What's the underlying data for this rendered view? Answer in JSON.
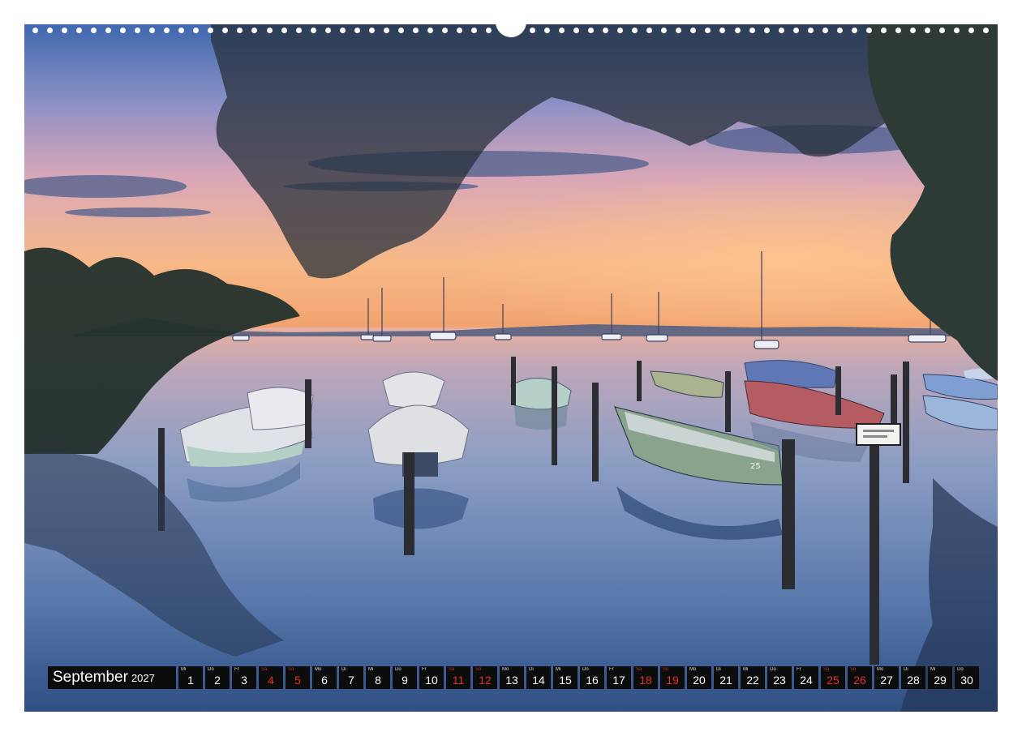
{
  "calendar": {
    "month": "September",
    "year": "2027",
    "days": [
      {
        "wd": "Mi",
        "n": "1",
        "hol": false
      },
      {
        "wd": "Do",
        "n": "2",
        "hol": false
      },
      {
        "wd": "Fr",
        "n": "3",
        "hol": false
      },
      {
        "wd": "Sa",
        "n": "4",
        "hol": true
      },
      {
        "wd": "So",
        "n": "5",
        "hol": true
      },
      {
        "wd": "Mo",
        "n": "6",
        "hol": false
      },
      {
        "wd": "Di",
        "n": "7",
        "hol": false
      },
      {
        "wd": "Mi",
        "n": "8",
        "hol": false
      },
      {
        "wd": "Do",
        "n": "9",
        "hol": false
      },
      {
        "wd": "Fr",
        "n": "10",
        "hol": false
      },
      {
        "wd": "Sa",
        "n": "11",
        "hol": true
      },
      {
        "wd": "So",
        "n": "12",
        "hol": true
      },
      {
        "wd": "Mo",
        "n": "13",
        "hol": false
      },
      {
        "wd": "Di",
        "n": "14",
        "hol": false
      },
      {
        "wd": "Mi",
        "n": "15",
        "hol": false
      },
      {
        "wd": "Do",
        "n": "16",
        "hol": false
      },
      {
        "wd": "Fr",
        "n": "17",
        "hol": false
      },
      {
        "wd": "Sa",
        "n": "18",
        "hol": true
      },
      {
        "wd": "So",
        "n": "19",
        "hol": true
      },
      {
        "wd": "Mo",
        "n": "20",
        "hol": false
      },
      {
        "wd": "Di",
        "n": "21",
        "hol": false
      },
      {
        "wd": "Mi",
        "n": "22",
        "hol": false
      },
      {
        "wd": "Do",
        "n": "23",
        "hol": false
      },
      {
        "wd": "Fr",
        "n": "24",
        "hol": false
      },
      {
        "wd": "Sa",
        "n": "25",
        "hol": true
      },
      {
        "wd": "So",
        "n": "26",
        "hol": true
      },
      {
        "wd": "Mo",
        "n": "27",
        "hol": false
      },
      {
        "wd": "Di",
        "n": "28",
        "hol": false
      },
      {
        "wd": "Mi",
        "n": "29",
        "hol": false
      },
      {
        "wd": "Do",
        "n": "30",
        "hol": false
      }
    ]
  },
  "boats": {
    "hull_number": "25"
  },
  "colors": {
    "sky_top": "#5b7fbe",
    "sky_glow": "#f4b07a",
    "water": "#4a6a9c",
    "holiday": "#e0332a",
    "calendar_bg": "#0c0c0c"
  }
}
